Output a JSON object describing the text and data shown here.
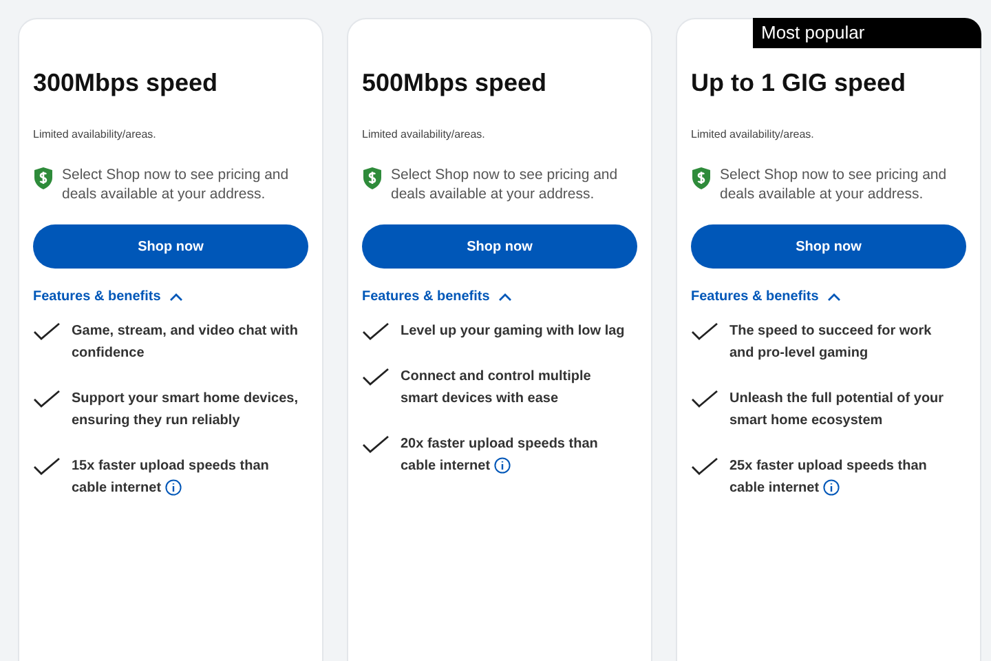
{
  "plans": [
    {
      "title": "300Mbps speed",
      "availability": "Limited availability/areas.",
      "pricing_note": "Select Shop now to see pricing and deals available at your address.",
      "button": "Shop now",
      "features_toggle": {
        "label": "Features & benefits",
        "expanded": true
      },
      "features": [
        {
          "text": "Game, stream, and video chat with confidence",
          "info": false
        },
        {
          "text": "Support your smart home devices, ensuring they run reliably",
          "info": false
        },
        {
          "text": "15x faster upload speeds than cable internet",
          "info": true
        }
      ]
    },
    {
      "title": "500Mbps speed",
      "availability": "Limited availability/areas.",
      "pricing_note": "Select Shop now to see pricing and deals available at your address.",
      "button": "Shop now",
      "features_toggle": {
        "label": "Features & benefits",
        "expanded": true
      },
      "features": [
        {
          "text": "Level up your gaming with low lag",
          "info": false
        },
        {
          "text": "Connect and control multiple smart devices with ease",
          "info": false
        },
        {
          "text": "20x faster upload speeds than cable internet",
          "info": true
        }
      ]
    },
    {
      "badge": "Most popular",
      "title": "Up to 1 GIG speed",
      "availability": "Limited availability/areas.",
      "pricing_note": "Select Shop now to see pricing and deals available at your address.",
      "button": "Shop now",
      "features_toggle": {
        "label": "Features & benefits",
        "expanded": true
      },
      "features": [
        {
          "text": "The speed to succeed for work and pro-level gaming",
          "info": false
        },
        {
          "text": "Unleash the full potential of your smart home ecosystem",
          "info": false
        },
        {
          "text": "25x faster upload speeds than cable internet",
          "info": true
        }
      ]
    }
  ]
}
